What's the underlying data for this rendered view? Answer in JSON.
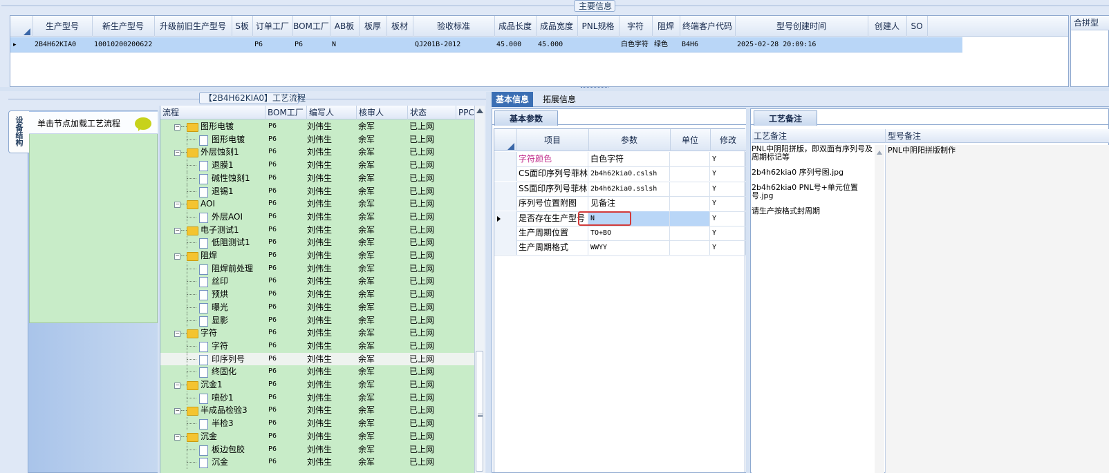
{
  "top": {
    "group_title": "主要信息",
    "right_header_partial": "合拼型",
    "columns": [
      "生产型号",
      "新生产型号",
      "升级前旧生产型号",
      "S板",
      "订单工厂",
      "BOM工厂",
      "AB板",
      "板厚",
      "板材",
      "验收标准",
      "成品长度",
      "成品宽度",
      "PNL规格",
      "字符",
      "阻焊",
      "终端客户代码",
      "型号创建时间",
      "创建人",
      "SO"
    ],
    "row": {
      "indicator": "▸",
      "cells": [
        "2B4H62KIA0",
        "10010200200622",
        "",
        "",
        "P6",
        "P6",
        "N",
        "",
        "",
        "QJ201B-2012",
        "45.000",
        "45.000",
        "",
        "白色字符",
        "绿色",
        "B4H6",
        "2025-02-28 20:09:16",
        "",
        ""
      ]
    }
  },
  "flow": {
    "title": "【2B4H62KIA0】工艺流程",
    "side_tab": "设备结构",
    "node_hint": "单击节点加载工艺流程",
    "columns": [
      "流程",
      "BOM工厂",
      "编写人",
      "核审人",
      "状态",
      "PPC"
    ],
    "rows": [
      {
        "name": "图形电镀",
        "level": 0,
        "folder": true,
        "bom": "P6",
        "writer": "刘伟生",
        "reviewer": "余军",
        "status": "已上网"
      },
      {
        "name": "图形电镀",
        "level": 1,
        "folder": false,
        "bom": "P6",
        "writer": "刘伟生",
        "reviewer": "余军",
        "status": "已上网"
      },
      {
        "name": "外层蚀刻1",
        "level": 0,
        "folder": true,
        "bom": "P6",
        "writer": "刘伟生",
        "reviewer": "余军",
        "status": "已上网"
      },
      {
        "name": "退膜1",
        "level": 1,
        "folder": false,
        "bom": "P6",
        "writer": "刘伟生",
        "reviewer": "余军",
        "status": "已上网"
      },
      {
        "name": "碱性蚀刻1",
        "level": 1,
        "folder": false,
        "bom": "P6",
        "writer": "刘伟生",
        "reviewer": "余军",
        "status": "已上网"
      },
      {
        "name": "退锡1",
        "level": 1,
        "folder": false,
        "bom": "P6",
        "writer": "刘伟生",
        "reviewer": "余军",
        "status": "已上网"
      },
      {
        "name": "AOI",
        "level": 0,
        "folder": true,
        "bom": "P6",
        "writer": "刘伟生",
        "reviewer": "余军",
        "status": "已上网"
      },
      {
        "name": "外层AOI",
        "level": 1,
        "folder": false,
        "bom": "P6",
        "writer": "刘伟生",
        "reviewer": "余军",
        "status": "已上网"
      },
      {
        "name": "电子测试1",
        "level": 0,
        "folder": true,
        "bom": "P6",
        "writer": "刘伟生",
        "reviewer": "余军",
        "status": "已上网"
      },
      {
        "name": "低阻测试1",
        "level": 1,
        "folder": false,
        "bom": "P6",
        "writer": "刘伟生",
        "reviewer": "余军",
        "status": "已上网"
      },
      {
        "name": "阻焊",
        "level": 0,
        "folder": true,
        "bom": "P6",
        "writer": "刘伟生",
        "reviewer": "余军",
        "status": "已上网"
      },
      {
        "name": "阻焊前处理",
        "level": 1,
        "folder": false,
        "bom": "P6",
        "writer": "刘伟生",
        "reviewer": "余军",
        "status": "已上网"
      },
      {
        "name": "丝印",
        "level": 1,
        "folder": false,
        "bom": "P6",
        "writer": "刘伟生",
        "reviewer": "余军",
        "status": "已上网"
      },
      {
        "name": "预烘",
        "level": 1,
        "folder": false,
        "bom": "P6",
        "writer": "刘伟生",
        "reviewer": "余军",
        "status": "已上网"
      },
      {
        "name": "曝光",
        "level": 1,
        "folder": false,
        "bom": "P6",
        "writer": "刘伟生",
        "reviewer": "余军",
        "status": "已上网"
      },
      {
        "name": "显影",
        "level": 1,
        "folder": false,
        "bom": "P6",
        "writer": "刘伟生",
        "reviewer": "余军",
        "status": "已上网"
      },
      {
        "name": "字符",
        "level": 0,
        "folder": true,
        "bom": "P6",
        "writer": "刘伟生",
        "reviewer": "余军",
        "status": "已上网"
      },
      {
        "name": "字符",
        "level": 1,
        "folder": false,
        "bom": "P6",
        "writer": "刘伟生",
        "reviewer": "余军",
        "status": "已上网"
      },
      {
        "name": "印序列号",
        "level": 1,
        "folder": false,
        "bom": "P6",
        "writer": "刘伟生",
        "reviewer": "余军",
        "status": "已上网",
        "selected": true
      },
      {
        "name": "终固化",
        "level": 1,
        "folder": false,
        "bom": "P6",
        "writer": "刘伟生",
        "reviewer": "余军",
        "status": "已上网"
      },
      {
        "name": "沉金1",
        "level": 0,
        "folder": true,
        "bom": "P6",
        "writer": "刘伟生",
        "reviewer": "余军",
        "status": "已上网"
      },
      {
        "name": "喷砂1",
        "level": 1,
        "folder": false,
        "bom": "P6",
        "writer": "刘伟生",
        "reviewer": "余军",
        "status": "已上网"
      },
      {
        "name": "半成品检验3",
        "level": 0,
        "folder": true,
        "bom": "P6",
        "writer": "刘伟生",
        "reviewer": "余军",
        "status": "已上网"
      },
      {
        "name": "半检3",
        "level": 1,
        "folder": false,
        "bom": "P6",
        "writer": "刘伟生",
        "reviewer": "余军",
        "status": "已上网"
      },
      {
        "name": "沉金",
        "level": 0,
        "folder": true,
        "bom": "P6",
        "writer": "刘伟生",
        "reviewer": "余军",
        "status": "已上网"
      },
      {
        "name": "板边包胶",
        "level": 1,
        "folder": false,
        "bom": "P6",
        "writer": "刘伟生",
        "reviewer": "余军",
        "status": "已上网"
      },
      {
        "name": "沉金",
        "level": 1,
        "folder": false,
        "bom": "P6",
        "writer": "刘伟生",
        "reviewer": "余军",
        "status": "已上网"
      }
    ]
  },
  "tabs": [
    "基本信息",
    "拓展信息"
  ],
  "basic": {
    "sub_tab": "基本参数",
    "columns": [
      "项目",
      "参数",
      "单位",
      "修改"
    ],
    "rows": [
      {
        "item": "字符颜色",
        "value": "白色字符",
        "unit": "",
        "modify": "Y",
        "highlight_item": true
      },
      {
        "item": "CS面印序列号菲林",
        "value": "2b4h62kia0.cslsh",
        "unit": "",
        "modify": "Y"
      },
      {
        "item": "SS面印序列号菲林",
        "value": "2b4h62kia0.sslsh",
        "unit": "",
        "modify": "Y"
      },
      {
        "item": "序列号位置附图",
        "value": "见备注",
        "unit": "",
        "modify": "Y"
      },
      {
        "item": "是否存在生产型号",
        "value": "N",
        "unit": "",
        "modify": "Y",
        "current": true
      },
      {
        "item": "生产周期位置",
        "value": "TO+BO",
        "unit": "",
        "modify": "Y"
      },
      {
        "item": "生产周期格式",
        "value": "WWYY",
        "unit": "",
        "modify": "Y"
      }
    ]
  },
  "notes": {
    "sub_tab": "工艺备注",
    "col_process": "工艺备注",
    "col_model": "型号备注",
    "process_lines": [
      "PNL中阴阳拼版，即双面有序列号及周期标记等",
      "2b4h62kia0 序列号图.jpg",
      "2b4h62kia0 PNL号+单元位置号.jpg",
      "请生产按格式封周期"
    ],
    "model_note": "PNL中阴阳拼版制作"
  },
  "colors": {
    "accent": "#3b6fb4",
    "selection": "#b9d6f7",
    "tree_bg": "#c8ecc8",
    "highlight_text": "#c02a8a",
    "red_box": "#d23a3a"
  }
}
